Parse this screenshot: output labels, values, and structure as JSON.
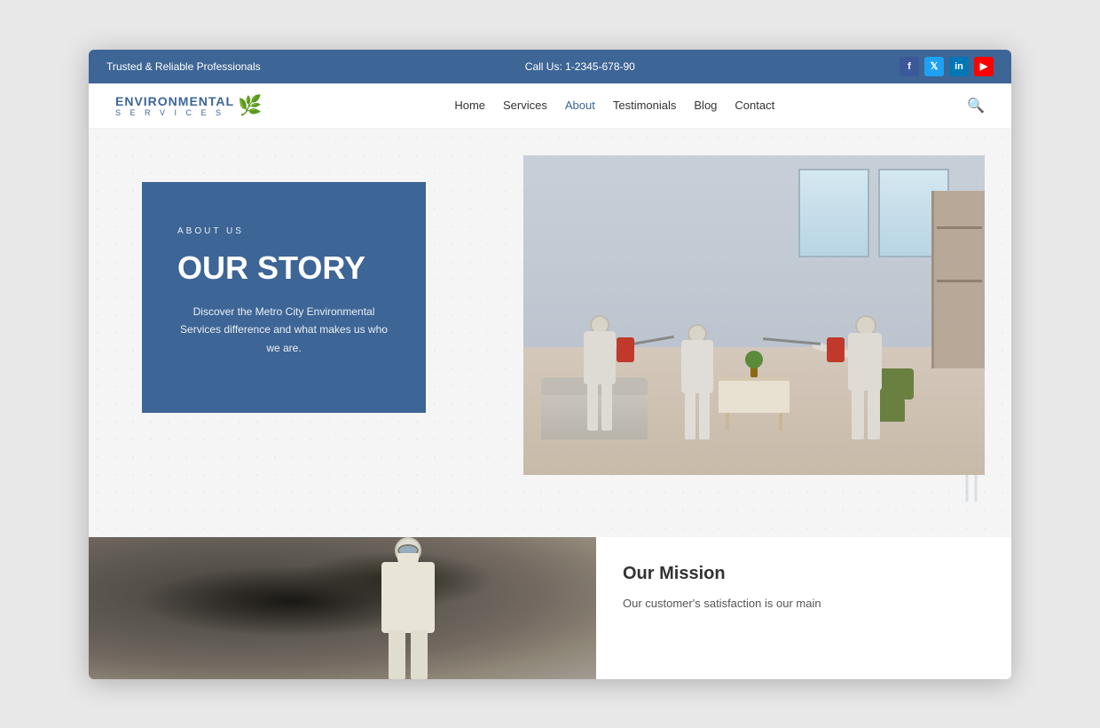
{
  "topbar": {
    "tagline": "Trusted & Reliable Professionals",
    "phone": "Call Us: 1-2345-678-90",
    "social": {
      "facebook": "f",
      "twitter": "t",
      "linkedin": "in",
      "youtube": "▶"
    }
  },
  "nav": {
    "logo_top": "ENVIRONMENTAL",
    "logo_bottom": "S E R V I C E S",
    "links": [
      "Home",
      "Services",
      "About",
      "Testimonials",
      "Blog",
      "Contact"
    ],
    "active_link": "About"
  },
  "hero": {
    "about_label": "ABOUT US",
    "heading": "OUR STORY",
    "description": "Discover the Metro City Environmental Services  difference and what makes us who we are."
  },
  "second_section": {
    "mission_title": "Our Mission",
    "mission_text": "Our customer's satisfaction is our main"
  }
}
